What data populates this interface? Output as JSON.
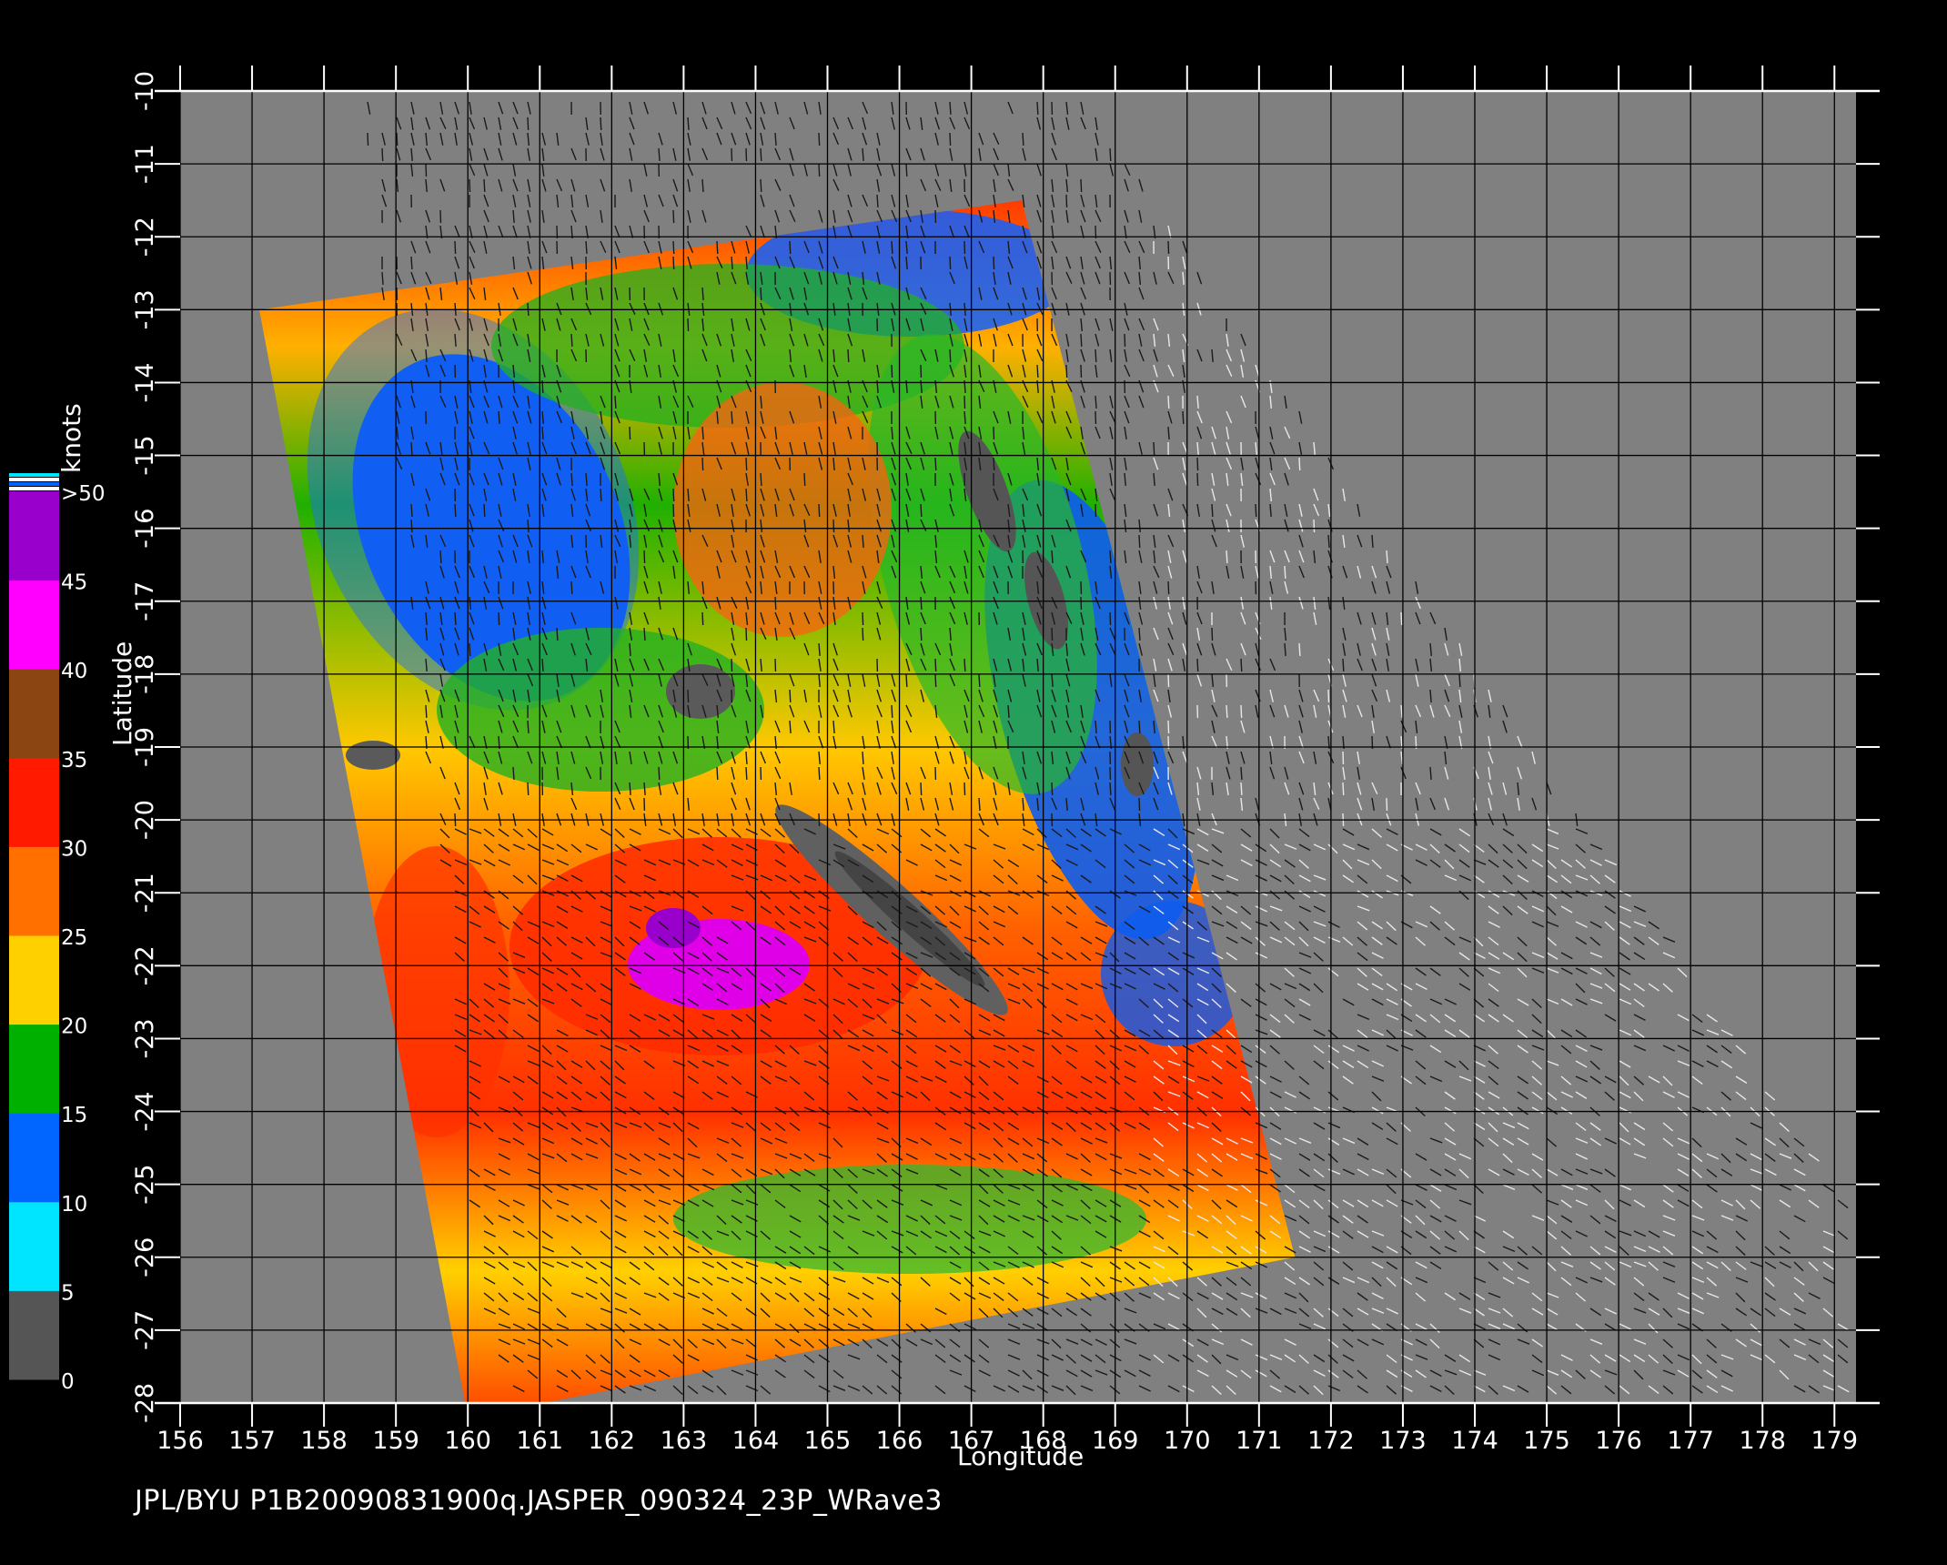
{
  "caption": "JPL/BYU  P1B20090831900q.JASPER_090324_23P_WRave3",
  "axes": {
    "x_title": "Longitude",
    "y_title": "Latitude",
    "x_ticks": [
      "156",
      "157",
      "158",
      "159",
      "160",
      "161",
      "162",
      "163",
      "164",
      "165",
      "166",
      "167",
      "168",
      "169",
      "170",
      "171",
      "172",
      "173",
      "174",
      "175",
      "176",
      "177",
      "178",
      "179"
    ],
    "y_ticks": [
      "-10",
      "-11",
      "-12",
      "-13",
      "-14",
      "-15",
      "-16",
      "-17",
      "-18",
      "-19",
      "-20",
      "-21",
      "-22",
      "-23",
      "-24",
      "-25",
      "-26",
      "-27",
      "-28"
    ],
    "x_range": [
      156,
      179.3
    ],
    "y_range": [
      -28,
      -10
    ]
  },
  "colorbar": {
    "units": "knots",
    "labels": [
      "0",
      "5",
      "10",
      "15",
      "20",
      "25",
      "30",
      "35",
      "40",
      "45",
      ">50"
    ],
    "colors": {
      "0-5": "#555555",
      "5-10": "#00e5ff",
      "10-15": "#0066ff",
      "15-20": "#00b000",
      "20-25": "#ffd000",
      "25-30": "#ff7000",
      "30-35": "#ff1a00",
      "35-40": "#8b4513",
      "40-45": "#ff00ff",
      "45-50": "#9900cc"
    }
  },
  "swath": {
    "corners_lonlat": [
      [
        157.1,
        -13.0
      ],
      [
        167.7,
        -11.5
      ],
      [
        171.5,
        -26.0
      ],
      [
        160.0,
        -28.2
      ]
    ]
  },
  "map_background": "#808080",
  "land_color": "#555555"
}
